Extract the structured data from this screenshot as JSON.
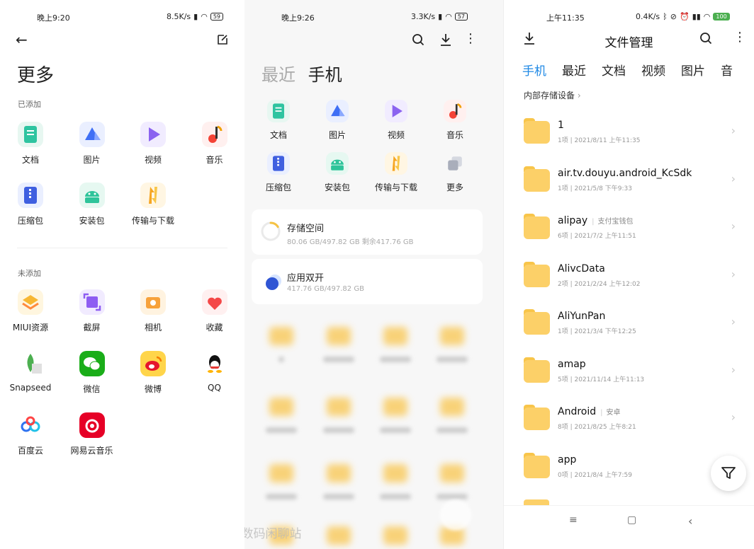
{
  "panel1": {
    "status": {
      "time": "晚上9:20",
      "net": "8.5K/s",
      "battery": "59"
    },
    "title": "更多",
    "added_label": "已添加",
    "not_added_label": "未添加",
    "added": [
      {
        "label": "文档",
        "icon": "document-icon"
      },
      {
        "label": "图片",
        "icon": "image-icon"
      },
      {
        "label": "视频",
        "icon": "video-icon"
      },
      {
        "label": "音乐",
        "icon": "music-icon"
      },
      {
        "label": "压缩包",
        "icon": "zip-icon"
      },
      {
        "label": "安装包",
        "icon": "android-icon"
      },
      {
        "label": "传输与下载",
        "icon": "transfer-icon"
      }
    ],
    "not_added": [
      {
        "label": "MIUI资源",
        "icon": "miui-resource-icon"
      },
      {
        "label": "截屏",
        "icon": "screenshot-icon"
      },
      {
        "label": "相机",
        "icon": "camera-icon"
      },
      {
        "label": "收藏",
        "icon": "favorite-icon"
      },
      {
        "label": "Snapseed",
        "icon": "snapseed-icon"
      },
      {
        "label": "微信",
        "icon": "wechat-icon"
      },
      {
        "label": "微博",
        "icon": "weibo-icon"
      },
      {
        "label": "QQ",
        "icon": "qq-icon"
      },
      {
        "label": "百度云",
        "icon": "baidu-cloud-icon"
      },
      {
        "label": "网易云音乐",
        "icon": "netease-music-icon"
      }
    ]
  },
  "panel2": {
    "status": {
      "time": "晚上9:26",
      "net": "3.3K/s",
      "battery": "57"
    },
    "tab_recent": "最近",
    "tab_phone": "手机",
    "categories": [
      {
        "label": "文档",
        "icon": "document-icon"
      },
      {
        "label": "图片",
        "icon": "image-icon"
      },
      {
        "label": "视频",
        "icon": "video-icon"
      },
      {
        "label": "音乐",
        "icon": "music-icon"
      },
      {
        "label": "压缩包",
        "icon": "zip-icon"
      },
      {
        "label": "安装包",
        "icon": "android-icon"
      },
      {
        "label": "传输与下载",
        "icon": "transfer-icon"
      },
      {
        "label": "更多",
        "icon": "more-icon"
      }
    ],
    "storage": {
      "title": "存储空间",
      "subtitle": "80.06 GB/497.82 GB   剩余417.76 GB",
      "used_fraction": 0.16
    },
    "dual_app": {
      "title": "应用双开",
      "subtitle": "417.76 GB/497.82 GB"
    },
    "watermark": "@数码闲聊站"
  },
  "panel3": {
    "status": {
      "time": "上午11:35",
      "net": "0.4K/s",
      "battery": "100"
    },
    "title": "文件管理",
    "tabs": [
      "手机",
      "最近",
      "文档",
      "视频",
      "图片",
      "音"
    ],
    "breadcrumb": "内部存储设备",
    "folders": [
      {
        "name": "1",
        "alias": "",
        "meta": "1项  |  2021/8/11 上午11:35"
      },
      {
        "name": "air.tv.douyu.android_KcSdk",
        "alias": "",
        "meta": "1项  |  2021/5/8 下午9:33"
      },
      {
        "name": "alipay",
        "alias": "支付宝钱包",
        "meta": "6项  |  2021/7/2 上午11:51"
      },
      {
        "name": "AlivcData",
        "alias": "",
        "meta": "2项  |  2021/2/24 上午12:02"
      },
      {
        "name": "AliYunPan",
        "alias": "",
        "meta": "1项  |  2021/3/4 下午12:25"
      },
      {
        "name": "amap",
        "alias": "",
        "meta": "5项  |  2021/11/14 上午11:13"
      },
      {
        "name": "Android",
        "alias": "安卓",
        "meta": "8项  |  2021/8/25 上午8:21"
      },
      {
        "name": "app",
        "alias": "",
        "meta": "0项  |  2021/8/4 上午7:59"
      }
    ]
  }
}
